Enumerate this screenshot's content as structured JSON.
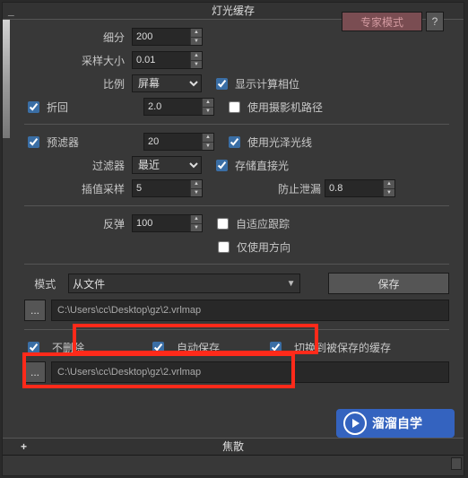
{
  "header": {
    "title": "灯光缓存"
  },
  "expert": {
    "label": "专家模式",
    "help": "?"
  },
  "params1": {
    "subdiv_label": "细分",
    "subdiv": "200",
    "sample_label": "采样大小",
    "sample": "0.01",
    "scale_label": "比例",
    "scale": "屏幕",
    "retrace_label": "折回",
    "retrace": "2.0",
    "show_phase_label": "显示计算相位",
    "cam_path_label": "使用摄影机路径"
  },
  "params2": {
    "prefilter_label": "预滤器",
    "prefilter": "20",
    "filter_label": "过滤器",
    "filter": "最近",
    "interp_label": "插值采样",
    "interp": "5",
    "glossy_label": "使用光泽光线",
    "direct_label": "存储直接光",
    "leak_label": "防止泄漏",
    "leak": "0.8"
  },
  "params3": {
    "bounces_label": "反弹",
    "bounces": "100",
    "adaptive_label": "自适应跟踪",
    "direction_label": "仅使用方向"
  },
  "mode": {
    "label": "模式",
    "value": "从文件",
    "save_btn": "保存",
    "browse": "...",
    "path": "C:\\Users\\cc\\Desktop\\gz\\2.vrlmap"
  },
  "opts": {
    "no_delete": "不删除",
    "auto_save": "自动保存",
    "switch_saved": "切换到被保存的缓存",
    "browse2": "...",
    "path2": "C:\\Users\\cc\\Desktop\\gz\\2.vrlmap"
  },
  "footer": {
    "caustics": "焦散"
  },
  "overlay": {
    "brand": "溜溜自学"
  }
}
